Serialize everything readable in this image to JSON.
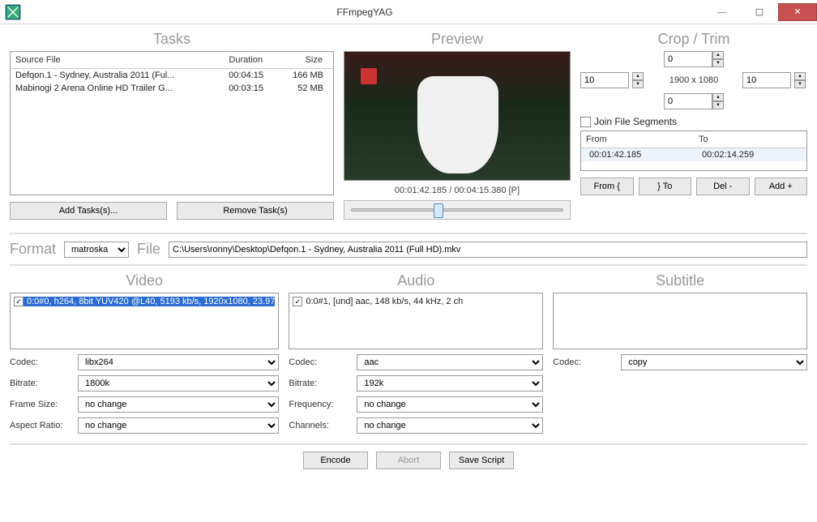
{
  "window": {
    "title": "FFmpegYAG"
  },
  "panels": {
    "tasks": "Tasks",
    "preview": "Preview",
    "crop": "Crop / Trim",
    "video": "Video",
    "audio": "Audio",
    "subtitle": "Subtitle"
  },
  "tasks": {
    "headers": {
      "source": "Source File",
      "duration": "Duration",
      "size": "Size"
    },
    "rows": [
      {
        "source": "Defqon.1 - Sydney, Australia 2011 (Ful...",
        "duration": "00:04:15",
        "size": "166 MB"
      },
      {
        "source": "Mabinogi 2 Arena Online HD Trailer G...",
        "duration": "00:03:15",
        "size": "52 MB"
      }
    ],
    "add_btn": "Add Tasks(s)...",
    "remove_btn": "Remove Task(s)"
  },
  "preview": {
    "time": "00:01:42.185 / 00:04:15.380 [P]"
  },
  "crop": {
    "top": "0",
    "left": "10",
    "right": "10",
    "bottom": "0",
    "dims": "1900 x 1080",
    "join_label": "Join File Segments",
    "seg_headers": {
      "from": "From",
      "to": "To"
    },
    "segments": [
      {
        "from": "00:01:42.185",
        "to": "00:02:14.259"
      }
    ],
    "buttons": {
      "from": "From {",
      "to": "} To",
      "del": "Del -",
      "add": "Add +"
    }
  },
  "format": {
    "format_label": "Format",
    "file_label": "File",
    "format_value": "matroska",
    "file_value": "C:\\Users\\ronny\\Desktop\\Defqon.1 - Sydney, Australia 2011 (Full HD).mkv"
  },
  "video": {
    "stream": "0:0#0, h264, 8bit YUV420 @L40, 5193 kb/s, 1920x1080, 23.97",
    "labels": {
      "codec": "Codec:",
      "bitrate": "Bitrate:",
      "framesize": "Frame Size:",
      "aspect": "Aspect Ratio:"
    },
    "codec": "libx264",
    "bitrate": "1800k",
    "framesize": "no change",
    "aspect": "no change"
  },
  "audio": {
    "stream": "0:0#1, [und] aac, 148 kb/s, 44 kHz, 2 ch",
    "labels": {
      "codec": "Codec:",
      "bitrate": "Bitrate:",
      "frequency": "Frequency:",
      "channels": "Channels:"
    },
    "codec": "aac",
    "bitrate": "192k",
    "frequency": "no change",
    "channels": "no change"
  },
  "subtitle": {
    "labels": {
      "codec": "Codec:"
    },
    "codec": "copy"
  },
  "footer": {
    "encode": "Encode",
    "abort": "Abort",
    "save": "Save Script"
  }
}
